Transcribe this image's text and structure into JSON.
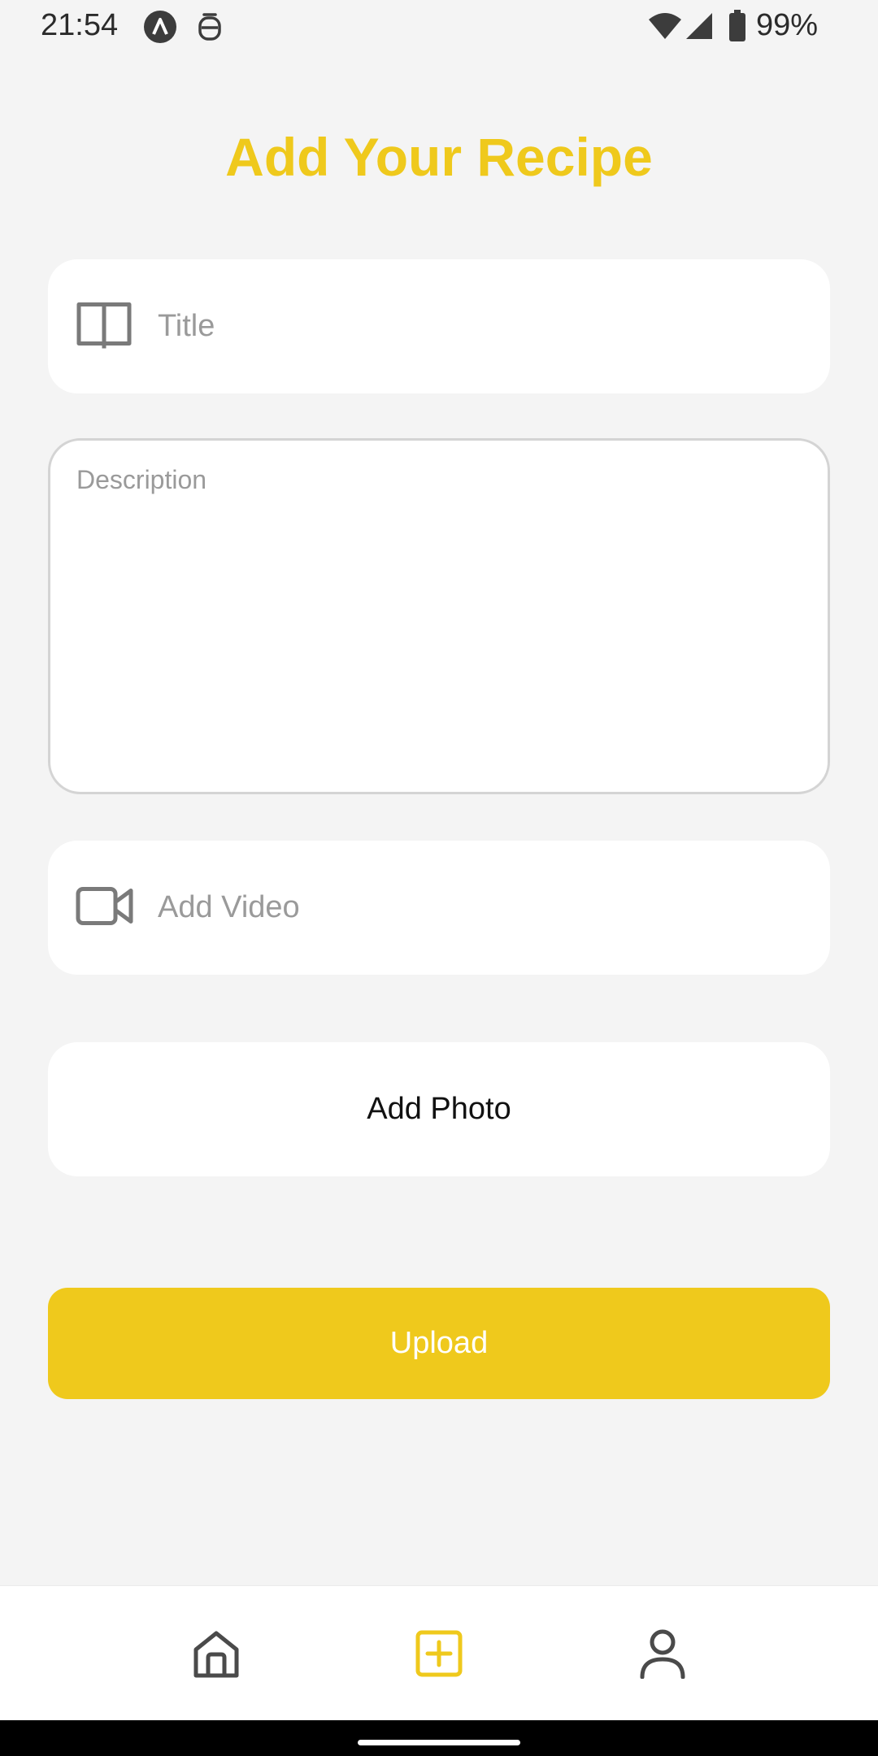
{
  "status_bar": {
    "time": "21:54",
    "battery": "99%",
    "icons": [
      "app-a-icon",
      "notification-icon",
      "wifi-icon",
      "signal-icon",
      "battery-icon"
    ]
  },
  "page": {
    "title": "Add Your Recipe"
  },
  "form": {
    "title_placeholder": "Title",
    "description_placeholder": "Description",
    "video_placeholder": "Add Video",
    "photo_label": "Add Photo",
    "upload_label": "Upload"
  },
  "bottom_nav": {
    "items": [
      {
        "icon": "home-icon",
        "active": false
      },
      {
        "icon": "add-square-icon",
        "active": true
      },
      {
        "icon": "profile-icon",
        "active": false
      }
    ]
  },
  "colors": {
    "accent": "#efc91c",
    "background": "#f4f4f4",
    "card": "#ffffff",
    "placeholder": "#9a9a9a"
  }
}
